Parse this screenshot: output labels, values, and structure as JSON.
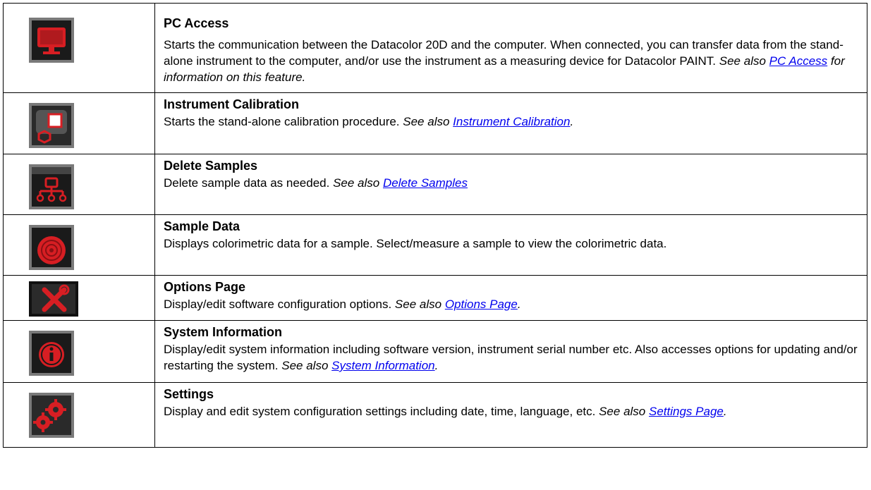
{
  "rows": [
    {
      "icon": "monitor-icon",
      "title": "PC Access",
      "desc": "Starts the communication between the Datacolor 20D and the computer. When connected, you can transfer data from the stand-alone instrument to the computer, and/or use the instrument as a measuring device for Datacolor PAINT.",
      "see_also": "See also",
      "link": "PC Access",
      "after": "for information on this feature."
    },
    {
      "icon": "calibration-icon",
      "title": "Instrument Calibration",
      "desc": "Starts the stand-alone calibration procedure.",
      "see_also": "See also",
      "link": "Instrument Calibration",
      "after": "."
    },
    {
      "icon": "delete-samples-icon",
      "title": "Delete Samples",
      "desc": "Delete sample data as needed.",
      "see_also": "See also",
      "link": "Delete Samples",
      "after": ""
    },
    {
      "icon": "target-icon",
      "title": "Sample Data",
      "desc": "Displays colorimetric data for a sample.  Select/measure a sample to view the colorimetric data."
    },
    {
      "icon": "tools-icon",
      "title": "Options Page",
      "desc": "Display/edit software configuration options.",
      "see_also": "See also",
      "link": "Options Page",
      "after": "."
    },
    {
      "icon": "info-icon",
      "title": "System Information",
      "desc": "Display/edit system information including software version, instrument serial number etc.  Also accesses options for updating and/or restarting the system.",
      "see_also": "See also",
      "link": "System Information",
      "after": "."
    },
    {
      "icon": "gears-icon",
      "title": "Settings",
      "desc": "Display and edit system configuration settings including date, time, language, etc.",
      "see_also": "See also",
      "link": "Settings Page",
      "after": "."
    }
  ],
  "colors": {
    "icon_red": "#d71e23",
    "icon_dark": "#1a1a1a",
    "icon_frame": "#7a7a7a",
    "link": "#0000ee"
  }
}
